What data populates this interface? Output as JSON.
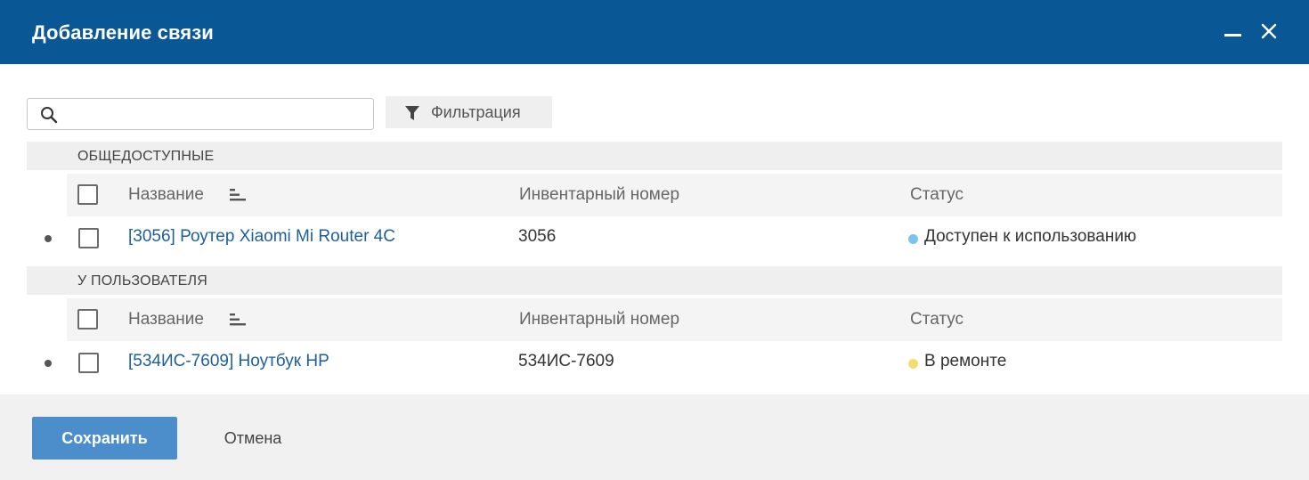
{
  "dialog": {
    "title": "Добавление связи",
    "minimize_icon": "minimize-icon",
    "close_icon": "close-icon",
    "header_color": "#0a5796"
  },
  "toolbar": {
    "search": {
      "value": "",
      "placeholder": "",
      "icon": "search-icon"
    },
    "filter_label": "Фильтрация",
    "filter_icon": "funnel-icon"
  },
  "columns": {
    "name": "Название",
    "inventory": "Инвентарный номер",
    "status": "Статус",
    "sort_icon": "sort-icon"
  },
  "groups": [
    {
      "title": "ОБЩЕДОСТУПНЫЕ",
      "rows": [
        {
          "name": "[3056] Роутер Xiaomi Mi Router 4C",
          "inventory": "3056",
          "status": "Доступен к использованию",
          "status_color": "#7cc4f0",
          "checked": false
        }
      ]
    },
    {
      "title": "У ПОЛЬЗОВАТЕЛЯ",
      "rows": [
        {
          "name": "[534ИС-7609] Ноутбук HP",
          "inventory": "534ИС-7609",
          "status": "В ремонте",
          "status_color": "#f6dc6e",
          "checked": false
        }
      ]
    }
  ],
  "footer": {
    "save_label": "Сохранить",
    "cancel_label": "Отмена",
    "save_color": "#4b8ecb"
  }
}
